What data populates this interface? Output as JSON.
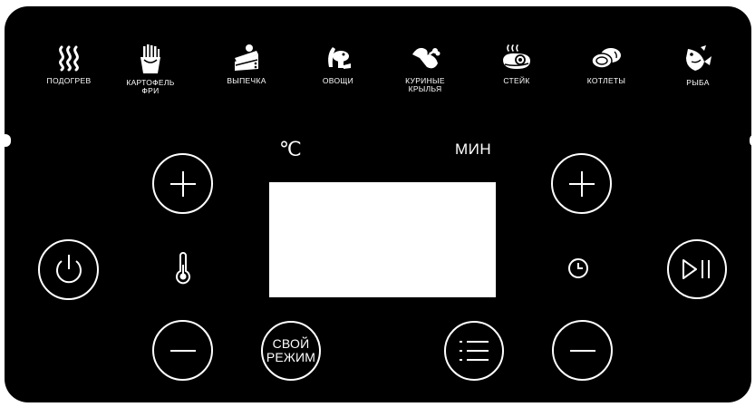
{
  "modes": [
    {
      "label": "ПОДОГРЕВ",
      "icon": "heat-waves-icon"
    },
    {
      "label": "КАРТОФЕЛЬ\nФРИ",
      "icon": "french-fries-icon"
    },
    {
      "label": "ВЫПЕЧКА",
      "icon": "cake-icon"
    },
    {
      "label": "ОВОЩИ",
      "icon": "vegetables-icon"
    },
    {
      "label": "КУРИНЫЕ\nКРЫЛЬЯ",
      "icon": "chicken-wings-icon"
    },
    {
      "label": "СТЕЙК",
      "icon": "steak-icon"
    },
    {
      "label": "КОТЛЕТЫ",
      "icon": "cutlets-icon"
    },
    {
      "label": "РЫБА",
      "icon": "fish-icon"
    }
  ],
  "units": {
    "temperature": "℃",
    "time": "МИН"
  },
  "controls": {
    "custom_mode_label": "СВОЙ\nРЕЖИМ",
    "power_icon": "power-icon",
    "temp_icon": "thermometer-icon",
    "time_icon": "clock-icon",
    "menu_icon": "menu-list-icon",
    "play_pause_icon": "play-pause-icon"
  },
  "colors": {
    "panel": "#000000",
    "foreground": "#ffffff",
    "display": "#ffffff"
  }
}
